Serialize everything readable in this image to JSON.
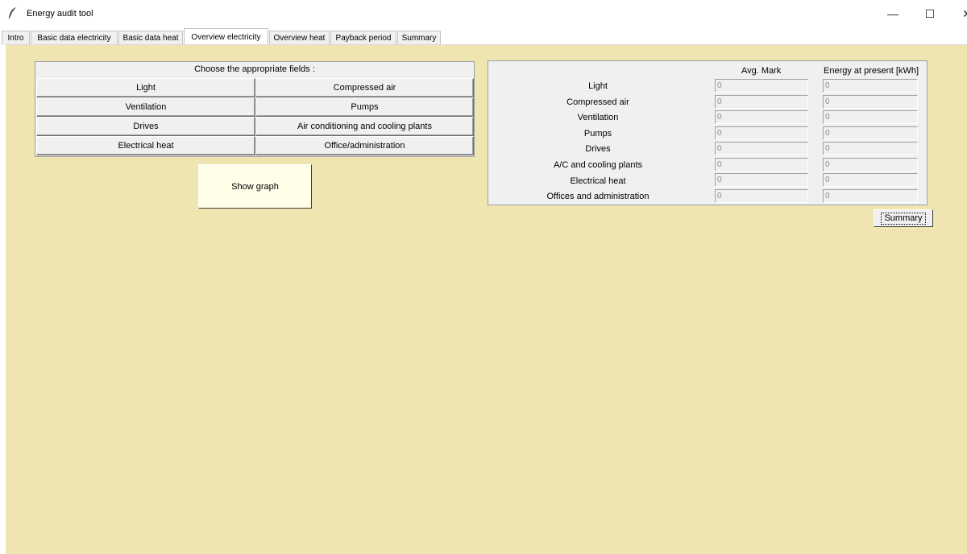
{
  "window": {
    "title": "Energy audit tool",
    "app_icon": "feather-icon",
    "controls": {
      "minimize": "—",
      "maximize": "☐",
      "close": "✕"
    }
  },
  "tabs": [
    {
      "label": "Intro",
      "active": false
    },
    {
      "label": "Basic data electricity",
      "active": false
    },
    {
      "label": "Basic data heat",
      "active": false
    },
    {
      "label": "Overview electricity",
      "active": true
    },
    {
      "label": "Overview heat",
      "active": false
    },
    {
      "label": "Payback period",
      "active": false
    },
    {
      "label": "Summary",
      "active": false
    }
  ],
  "fields_panel": {
    "header": "Choose the appropriate fields :",
    "buttons": [
      "Light",
      "Compressed air",
      "Ventilation",
      "Pumps",
      "Drives",
      "Air conditioning and cooling plants",
      "Electrical heat",
      "Office/administration"
    ]
  },
  "show_graph_label": "Show graph",
  "overview": {
    "col_avg_mark": "Avg. Mark",
    "col_energy": "Energy at present [kWh]",
    "rows": [
      {
        "label": "Light",
        "avg_mark": "0",
        "energy": "0"
      },
      {
        "label": "Compressed air",
        "avg_mark": "0",
        "energy": "0"
      },
      {
        "label": "Ventilation",
        "avg_mark": "0",
        "energy": "0"
      },
      {
        "label": "Pumps",
        "avg_mark": "0",
        "energy": "0"
      },
      {
        "label": "Drives",
        "avg_mark": "0",
        "energy": "0"
      },
      {
        "label": "A/C and cooling plants",
        "avg_mark": "0",
        "energy": "0"
      },
      {
        "label": "Electrical heat",
        "avg_mark": "0",
        "energy": "0"
      },
      {
        "label": "Offices and administration",
        "avg_mark": "0",
        "energy": "0"
      }
    ]
  },
  "summary_label": "Summary",
  "colors": {
    "content_bg": "#eee5b0",
    "panel_bg": "#f0f0f0",
    "show_graph_bg": "#fffee8"
  }
}
